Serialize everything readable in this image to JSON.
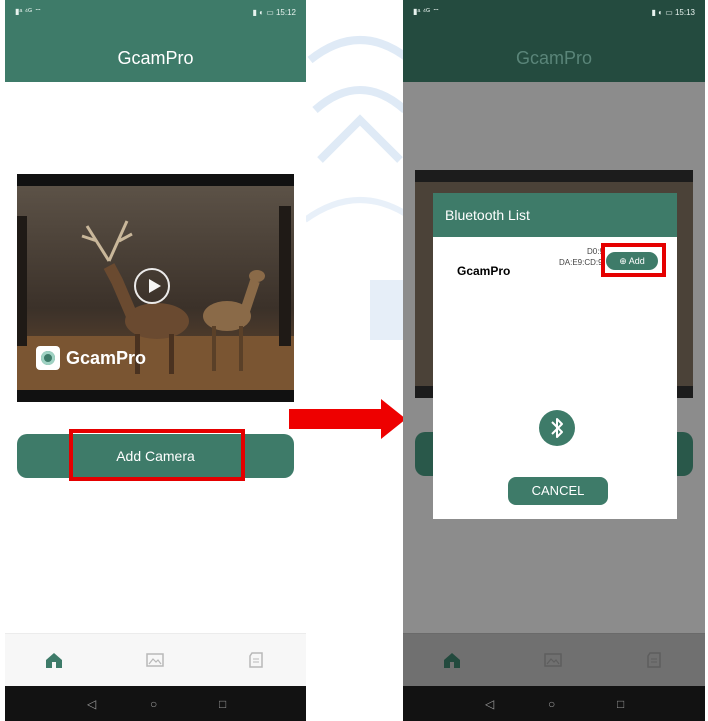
{
  "left_screen": {
    "status": {
      "left": "▮ᵃ ⁴ᴳ ⌔",
      "right": "▮ ◐ ▭ 15:12"
    },
    "app_title": "GcamPro",
    "hero": {
      "brand": "GcamPro",
      "play_icon": "play-circle-icon"
    },
    "add_camera_label": "Add Camera",
    "bottom_nav": {
      "icons": [
        "home-icon",
        "gallery-icon",
        "sd-card-icon"
      ]
    },
    "system_nav": {
      "back": "◁",
      "home": "○",
      "recents": "□"
    }
  },
  "right_screen": {
    "status": {
      "left": "▮ᵃ ⁴ᴳ ⌔",
      "right": "▮ ◐ ▭ 15:13"
    },
    "app_title": "GcamPro",
    "dialog": {
      "title": "Bluetooth List",
      "device": {
        "name": "GcamPro",
        "mac_line1": "D0:9",
        "mac_line2": "DA:E9:CD:9",
        "add_label": "⊕ Add"
      },
      "bluetooth_icon": "bluetooth-icon",
      "cancel_label": "CANCEL"
    },
    "bottom_nav": {
      "icons": [
        "home-icon",
        "gallery-icon",
        "sd-card-icon"
      ]
    },
    "system_nav": {
      "back": "◁",
      "home": "○",
      "recents": "□"
    }
  },
  "colors": {
    "primary": "#3e7b69",
    "highlight": "#e50000",
    "arrow": "#ee0000"
  }
}
